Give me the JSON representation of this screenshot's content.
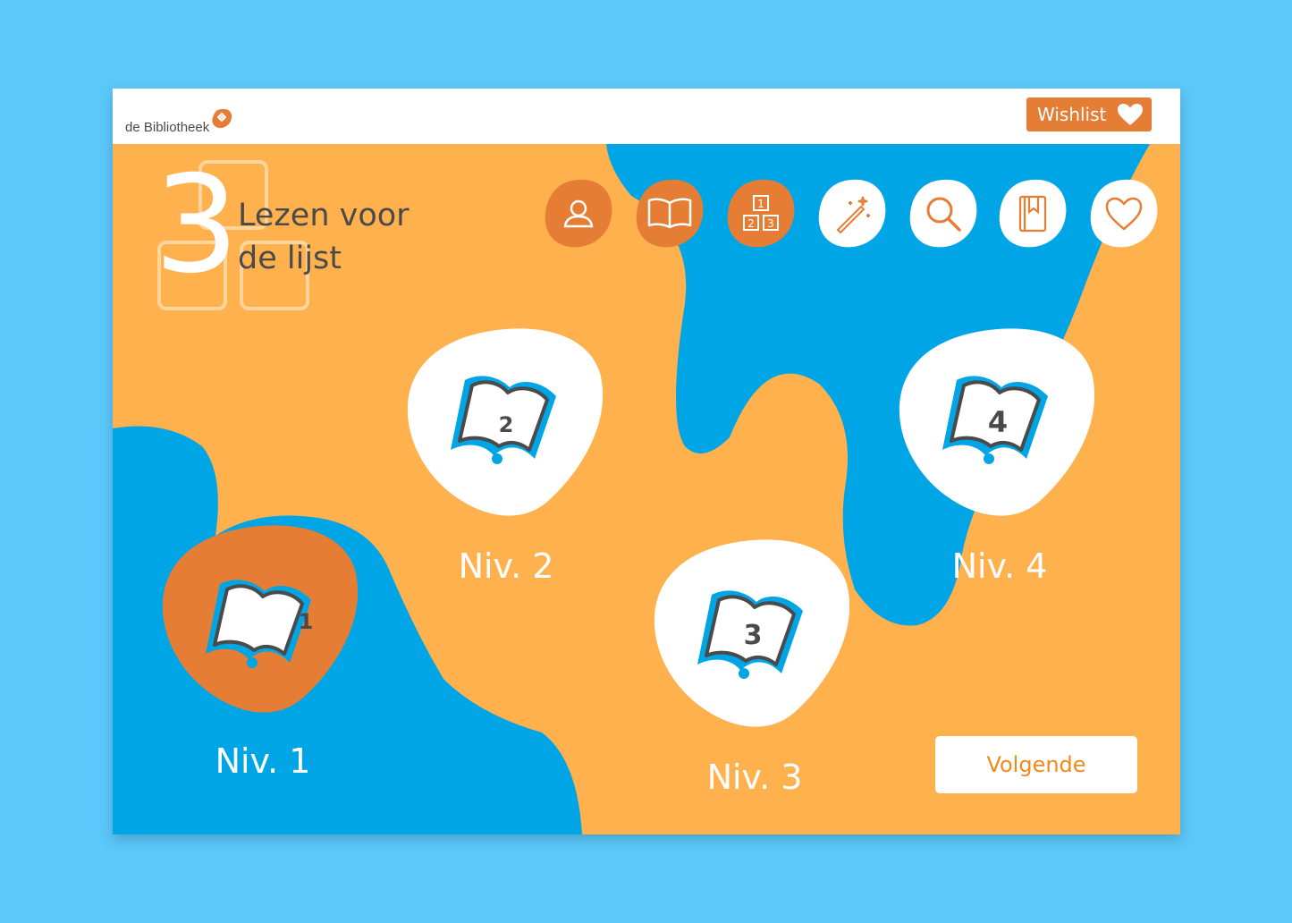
{
  "brand": {
    "logo_text": "de Bibliotheek"
  },
  "topbar": {
    "wishlist_label": "Wishlist"
  },
  "title": {
    "step_number": "3",
    "line1": "Lezen voor",
    "line2": "de lijst"
  },
  "nav": {
    "items": [
      {
        "icon": "user-icon",
        "active": true
      },
      {
        "icon": "book-icon",
        "active": true
      },
      {
        "icon": "levels-icon",
        "active": true
      },
      {
        "icon": "magic-wand-icon",
        "active": false
      },
      {
        "icon": "search-icon",
        "active": false
      },
      {
        "icon": "bookmark-book-icon",
        "active": false
      },
      {
        "icon": "heart-icon",
        "active": false
      }
    ]
  },
  "levels": [
    {
      "number": "1",
      "label": "Niv. 1",
      "selected": true
    },
    {
      "number": "2",
      "label": "Niv. 2",
      "selected": false
    },
    {
      "number": "3",
      "label": "Niv. 3",
      "selected": false
    },
    {
      "number": "4",
      "label": "Niv. 4",
      "selected": false
    }
  ],
  "next_button": {
    "label": "Volgende"
  },
  "colors": {
    "page_bg": "#5bc8fa",
    "orange_bg": "#ffb14e",
    "blue_blob": "#00a5e6",
    "accent_orange": "#e67d35",
    "text_dark": "#4a4a4a",
    "next_text": "#f28a1a"
  }
}
